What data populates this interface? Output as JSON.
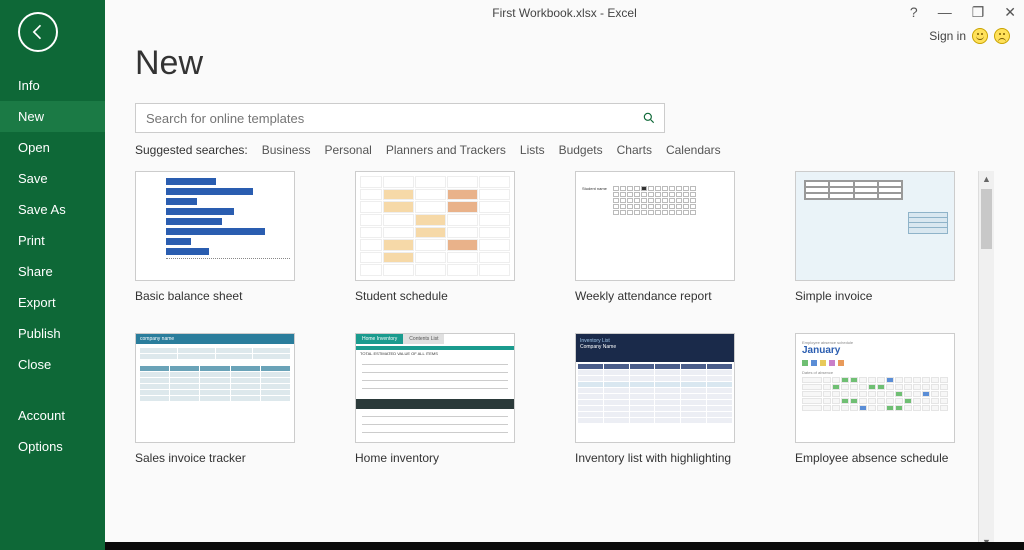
{
  "titlebar": {
    "title": "First Workbook.xlsx - Excel",
    "help": "?",
    "minimize": "—",
    "restore": "❐",
    "close": "✕"
  },
  "signin": {
    "label": "Sign in"
  },
  "sidebar": {
    "items": [
      {
        "label": "Info"
      },
      {
        "label": "New"
      },
      {
        "label": "Open"
      },
      {
        "label": "Save"
      },
      {
        "label": "Save As"
      },
      {
        "label": "Print"
      },
      {
        "label": "Share"
      },
      {
        "label": "Export"
      },
      {
        "label": "Publish"
      },
      {
        "label": "Close"
      }
    ],
    "footer": [
      {
        "label": "Account"
      },
      {
        "label": "Options"
      }
    ]
  },
  "page": {
    "title": "New",
    "search_placeholder": "Search for online templates",
    "suggested_label": "Suggested searches:",
    "suggested": [
      "Business",
      "Personal",
      "Planners and Trackers",
      "Lists",
      "Budgets",
      "Charts",
      "Calendars"
    ]
  },
  "templates_row1": [
    {
      "label": "Basic balance sheet"
    },
    {
      "label": "Student schedule"
    },
    {
      "label": "Weekly attendance report"
    },
    {
      "label": "Simple invoice"
    }
  ],
  "templates_row2": [
    {
      "label": "Sales invoice tracker"
    },
    {
      "label": "Home inventory"
    },
    {
      "label": "Inventory list with highlighting"
    },
    {
      "label": "Employee absence schedule"
    }
  ],
  "thumb_text": {
    "sales_header": "company name",
    "home_tab1": "Home Inventory",
    "home_tab2": "Contents List",
    "home_band": "TOTAL ESTIMATED VALUE OF ALL ITEMS",
    "inv_top1": "Inventory List",
    "inv_top2": "Company Name",
    "abs_title": "Employee absence schedule",
    "abs_month": "January",
    "abs_dates": "Dates of absence"
  }
}
